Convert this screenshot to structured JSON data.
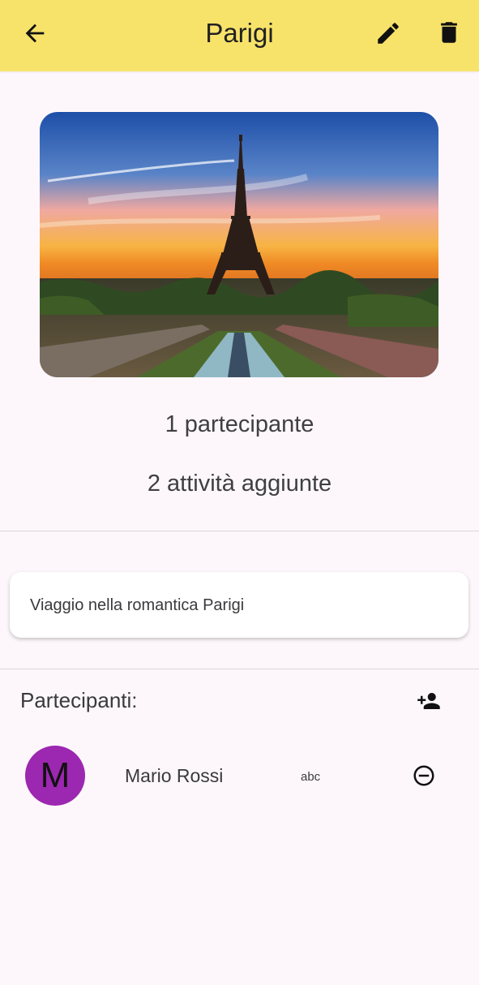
{
  "app_bar": {
    "title": "Parigi",
    "background_color": "#f8e36a",
    "back_icon": "arrow-back-icon",
    "edit_icon": "pencil-icon",
    "delete_icon": "trash-icon"
  },
  "trip": {
    "image": "eiffel-tower-sunset-photo",
    "participants_text": "1 partecipante",
    "activities_text": "2 attività aggiunte",
    "description": "Viaggio nella romantica Parigi"
  },
  "participants_section": {
    "title": "Partecipanti:",
    "add_icon": "person-add-icon",
    "items": [
      {
        "avatar_letter": "M",
        "avatar_color": "#9c27b0",
        "name": "Mario Rossi",
        "note": "abc",
        "remove_icon": "remove-circle-icon"
      }
    ]
  }
}
